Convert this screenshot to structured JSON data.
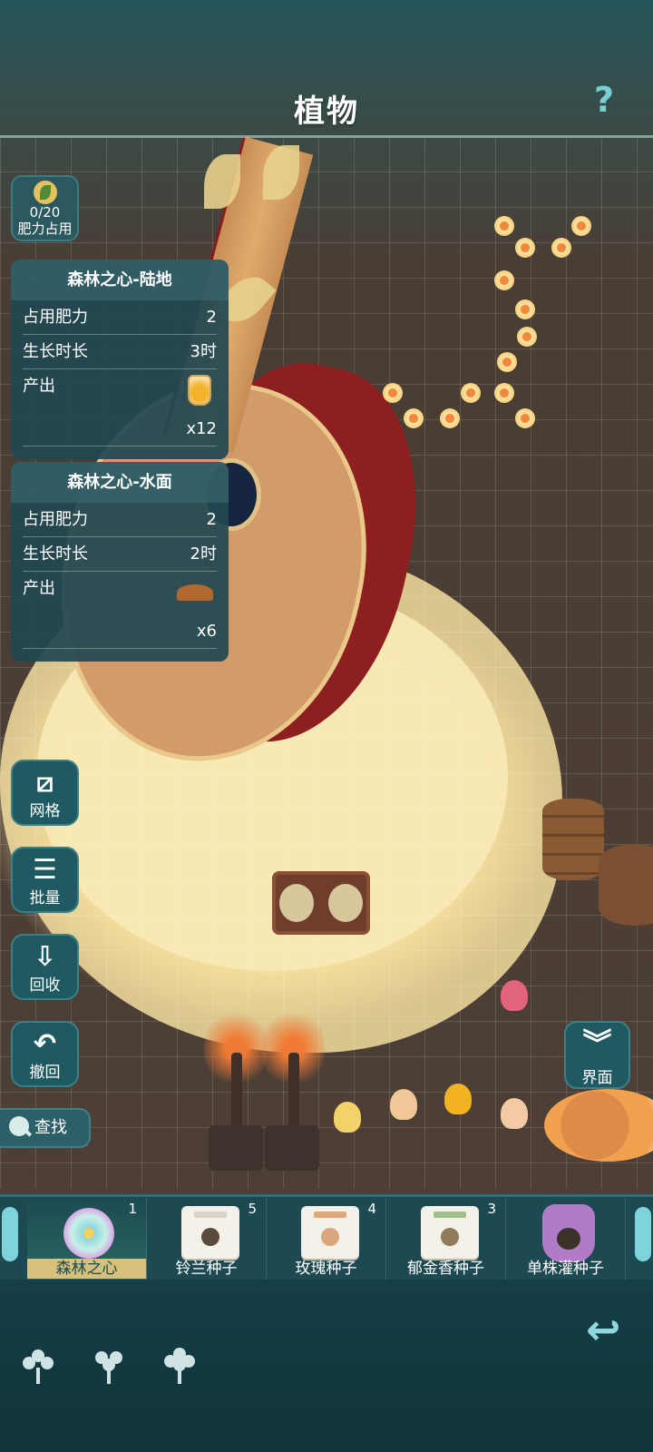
{
  "header": {
    "title": "植物",
    "help_icon": "?"
  },
  "fertilizer": {
    "value": "0/20",
    "label": "肥力占用"
  },
  "cards": [
    {
      "title": "森林之心-陆地",
      "rows": [
        {
          "label": "占用肥力",
          "value": "2"
        },
        {
          "label": "生长时长",
          "value": "3时"
        }
      ],
      "output_label": "产出",
      "output_count": "x12",
      "output_icon": "honey-jar-icon"
    },
    {
      "title": "森林之心-水面",
      "rows": [
        {
          "label": "占用肥力",
          "value": "2"
        },
        {
          "label": "生长时长",
          "value": "2时"
        }
      ],
      "output_label": "产出",
      "output_count": "x6",
      "output_icon": "soil-mound-icon"
    }
  ],
  "side_buttons": {
    "grid": "网格",
    "batch": "批量",
    "recycle": "回收",
    "undo": "撤回"
  },
  "find_button": "查找",
  "ui_button": "界面",
  "tray": {
    "items": [
      {
        "name": "森林之心",
        "count": "1",
        "selected": true
      },
      {
        "name": "铃兰种子",
        "count": "5"
      },
      {
        "name": "玫瑰种子",
        "count": "4"
      },
      {
        "name": "郁金香种子",
        "count": "3"
      },
      {
        "name": "单株灌种子",
        "count": ""
      }
    ]
  },
  "bottom_tabs": [
    "flower-icon",
    "plant-icon",
    "crop-icon"
  ],
  "colors": {
    "panel": "#214852",
    "accent": "#7fd3da",
    "selected": "#d6c07a"
  }
}
